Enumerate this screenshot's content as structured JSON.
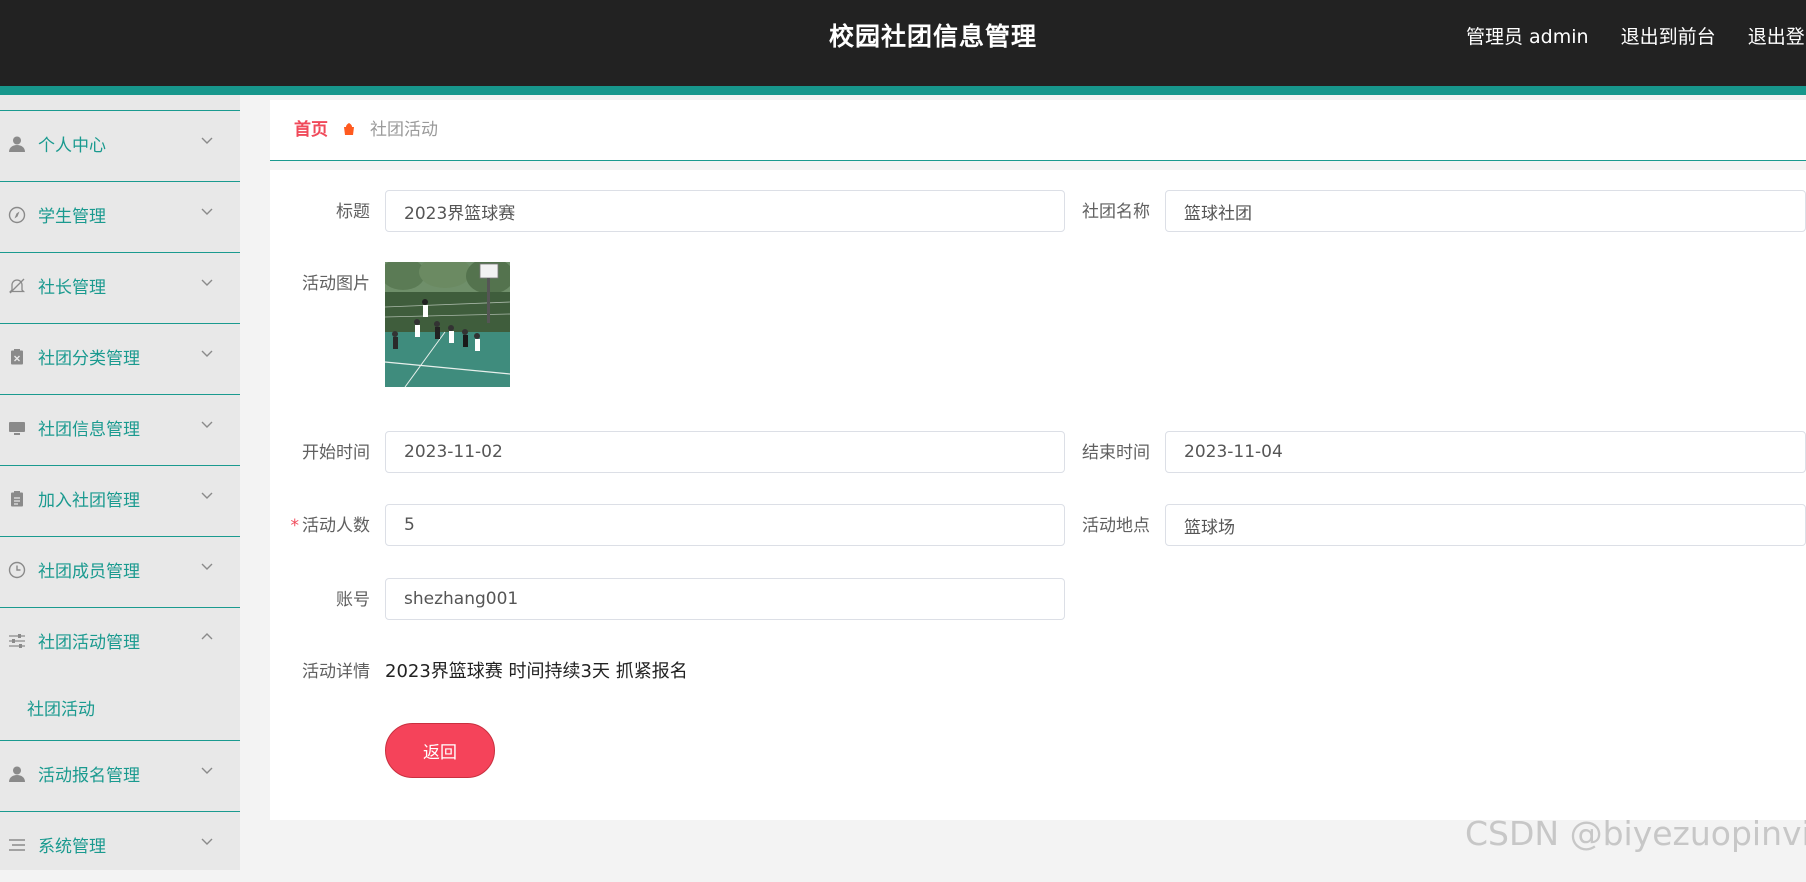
{
  "header": {
    "app_title": "校园社团信息管理",
    "admin_text": "管理员 admin",
    "exit_front_label": "退出到前台",
    "logout_label": "退出登录"
  },
  "sidebar": {
    "items": [
      {
        "label": "个人中心",
        "icon": "user-icon"
      },
      {
        "label": "学生管理",
        "icon": "compass-icon"
      },
      {
        "label": "社长管理",
        "icon": "bell-off-icon"
      },
      {
        "label": "社团分类管理",
        "icon": "clipboard-x-icon"
      },
      {
        "label": "社团信息管理",
        "icon": "monitor-icon"
      },
      {
        "label": "加入社团管理",
        "icon": "clipboard-icon"
      },
      {
        "label": "社团成员管理",
        "icon": "clock-icon"
      },
      {
        "label": "社团活动管理",
        "icon": "sliders-icon",
        "expanded": true
      },
      {
        "label": "活动报名管理",
        "icon": "user-icon"
      },
      {
        "label": "系统管理",
        "icon": "list-icon"
      }
    ],
    "submenu": {
      "label": "社团活动"
    }
  },
  "breadcrumb": {
    "home": "首页",
    "current": "社团活动"
  },
  "form": {
    "title_label": "标题",
    "title_value": "2023界篮球赛",
    "club_name_label": "社团名称",
    "club_name_value": "篮球社团",
    "image_label": "活动图片",
    "start_time_label": "开始时间",
    "start_time_value": "2023-11-02",
    "end_time_label": "结束时间",
    "end_time_value": "2023-11-04",
    "participants_label": "活动人数",
    "participants_required": "*",
    "participants_value": "5",
    "location_label": "活动地点",
    "location_value": "篮球场",
    "account_label": "账号",
    "account_value": "shezhang001",
    "detail_label": "活动详情",
    "detail_value": "2023界篮球赛 时间持续3天 抓紧报名",
    "back_button_label": "返回"
  },
  "watermark": "CSDN @biyezuopinvip",
  "colors": {
    "topbar": "#222222",
    "accent": "#17978c",
    "menu_text": "#1a9a8f",
    "primary_button": "#f5435a",
    "breadcrumb_home": "#f04a5a"
  }
}
